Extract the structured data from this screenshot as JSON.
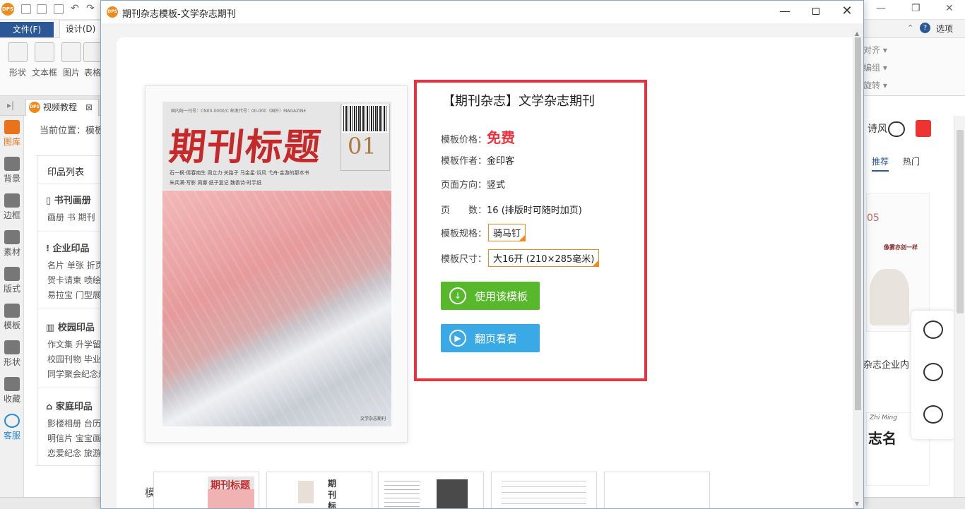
{
  "app": {
    "logo": "DPS",
    "menu_file": "文件(F)",
    "menu_design": "设计(D)",
    "ribbon_tools": [
      "形状",
      "文本框",
      "图片",
      "表格"
    ],
    "ribbon_right": [
      "对齐",
      "编组",
      "旋转"
    ],
    "help_label": "选项",
    "doc_tab": "视频教程",
    "breadcrumb": "当前位置：模板",
    "rail": [
      {
        "label": "图库",
        "icon": "gallery-icon"
      },
      {
        "label": "背景",
        "icon": "background-icon"
      },
      {
        "label": "边框",
        "icon": "border-icon"
      },
      {
        "label": "素材",
        "icon": "material-icon"
      },
      {
        "label": "版式",
        "icon": "layout-icon"
      },
      {
        "label": "模板",
        "icon": "template-icon"
      },
      {
        "label": "形状",
        "icon": "shape-icon"
      },
      {
        "label": "收藏",
        "icon": "star-icon"
      },
      {
        "label": "客服",
        "icon": "service-icon"
      }
    ],
    "list_panel": {
      "title": "印品列表",
      "sections": [
        {
          "name": "书刊画册",
          "rows": [
            "画册 书 期刊"
          ]
        },
        {
          "name": "企业印品",
          "rows": [
            "名片 单张 折页",
            "贺卡请柬 喷绘",
            "易拉宝 门型展架"
          ]
        },
        {
          "name": "校园印品",
          "rows": [
            "作文集 升学留念",
            "校园刊物 毕业纪念",
            "同学聚会纪念册"
          ]
        },
        {
          "name": "家庭印品",
          "rows": [
            "影楼相册 台历",
            "明信片 宝宝画册",
            "恋爱纪念 旅游"
          ]
        }
      ]
    },
    "right_panel": {
      "partial_text": "诗风",
      "tab_recommend": "推荐",
      "tab_hot": "热门",
      "thumb1_number": "05",
      "thumb1_caption": "像雾亦剑一样",
      "label": "杂志企业内",
      "thumb2_en": "Zhi Ming",
      "thumb2_sig": "志名"
    }
  },
  "modal": {
    "logo": "DPS",
    "title": "期刊杂志模板-文学杂志期刊",
    "cover": {
      "top_text": "国内统一刊号：CN00-0000/C  邮发代号：00-000（国外）MAGAZINE",
      "title": "期刊标题",
      "issue": "01",
      "authors_line1": "石一枫·倩春南生  周立力·关路子  马金星·诉风  弋舟·金游的那本书",
      "authors_line2": "朱兵满·写影  周娜·纸子复记  魏香诗·时手纸",
      "footer": "文学杂志期刊"
    },
    "info": {
      "title": "【期刊杂志】文学杂志期刊",
      "price_label": "模板价格：",
      "price_value": "免费",
      "author_label": "模板作者：",
      "author_value": "金印客",
      "orientation_label": "页面方向：",
      "orientation_value": "竖式",
      "pages_label": "页　　数：",
      "pages_value": "16 (排版时可随时加页)",
      "spec_label": "模板规格：",
      "spec_value": "骑马钉",
      "size_label": "模板尺寸：",
      "size_value": "大16开 (210×285毫米)",
      "use_button": "使用该模板",
      "flip_button": "翻页看看"
    },
    "showcase_title": "模板展示",
    "showcase_thumb1_title": "期刊标题",
    "showcase_thumb2_title": "期刊标题"
  },
  "colors": {
    "accent_red": "#e8333e",
    "use_green": "#57b82b",
    "flip_blue": "#3aaae6",
    "brand_orange": "#f08a1e"
  }
}
